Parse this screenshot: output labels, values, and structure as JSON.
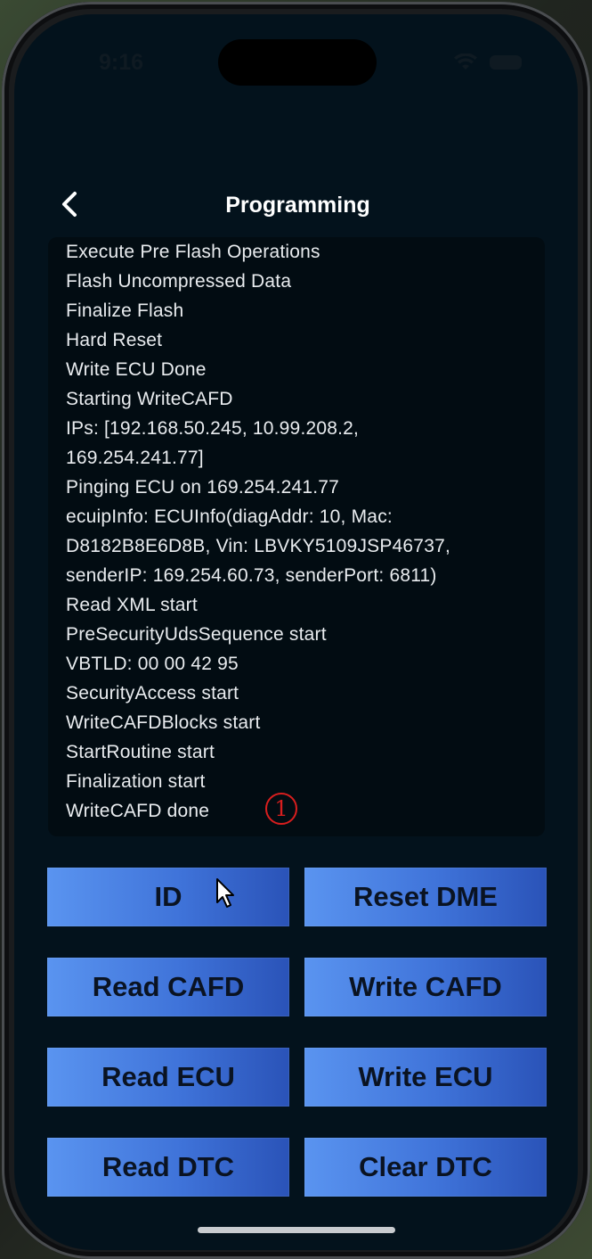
{
  "status_bar": {
    "time": "9:16",
    "icons": [
      "wifi-icon",
      "battery-icon"
    ]
  },
  "header": {
    "back_icon": "chevron-left-icon",
    "title": "Programming"
  },
  "log": {
    "lines": [
      "Execute Pre Flash Operations",
      "Flash Uncompressed Data",
      "Finalize Flash",
      "Hard Reset",
      "Write ECU Done",
      "Starting WriteCAFD",
      "IPs: [192.168.50.245, 10.99.208.2,",
      "169.254.241.77]",
      "Pinging ECU on 169.254.241.77",
      "ecuipInfo: ECUInfo(diagAddr: 10, Mac:",
      "D8182B8E6D8B, Vin: LBVKY5109JSP46737,",
      "senderIP: 169.254.60.73, senderPort: 6811)",
      "Read XML start",
      "PreSecurityUdsSequence start",
      "VBTLD: 00 00 42 95",
      "SecurityAccess start",
      "WriteCAFDBlocks start",
      "StartRoutine start",
      "Finalization start",
      "WriteCAFD done"
    ],
    "annotation": "1"
  },
  "buttons": {
    "id": "ID",
    "reset_dme": "Reset DME",
    "read_cafd": "Read CAFD",
    "write_cafd": "Write CAFD",
    "read_ecu": "Read ECU",
    "write_ecu": "Write ECU",
    "read_dtc": "Read DTC",
    "clear_dtc": "Clear DTC"
  },
  "colors": {
    "screen_bg": "#03121c",
    "log_bg": "#020c12",
    "button_gradient_start": "#5a94f0",
    "button_gradient_end": "#2a53b8",
    "annotation": "#d81e1e"
  }
}
